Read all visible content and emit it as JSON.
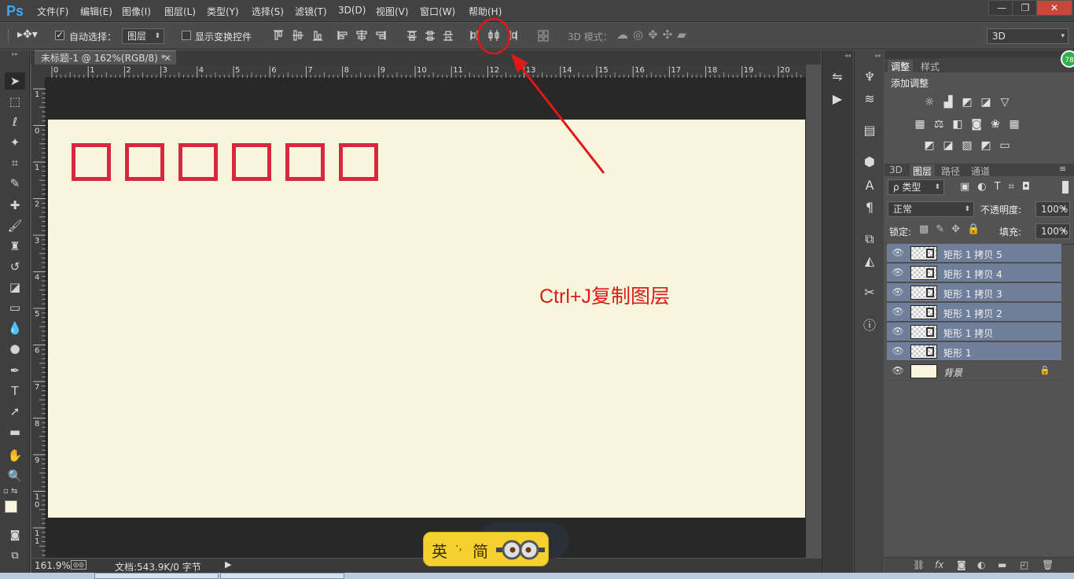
{
  "app": {
    "logo": "Ps",
    "menu": [
      "文件(F)",
      "编辑(E)",
      "图像(I)",
      "图层(L)",
      "类型(Y)",
      "选择(S)",
      "滤镜(T)",
      "3D(D)",
      "视图(V)",
      "窗口(W)",
      "帮助(H)"
    ],
    "window_controls": [
      "—",
      "❐",
      "✕"
    ]
  },
  "options_bar": {
    "auto_select_label": "自动选择：",
    "auto_select_checked": true,
    "auto_select_target": "图层",
    "show_transform_label": "显示变换控件",
    "show_transform_checked": false,
    "mode_3d_label": "3D 模式：",
    "workspace_select": "3D"
  },
  "document": {
    "tab_title": "未标题-1 @ 162%(RGB/8) *",
    "zoom": "161.9%",
    "doc_info": "文档:543.9K/0 字节",
    "canvas_color": "#f8f7de",
    "box_color": "#d8283f",
    "box_count": 6
  },
  "rulers": {
    "h_ticks": [
      "0",
      "1",
      "2",
      "3",
      "4",
      "5",
      "6",
      "7",
      "8",
      "9",
      "10",
      "11",
      "12",
      "13",
      "14",
      "15",
      "16",
      "17",
      "18",
      "19",
      "20"
    ],
    "v_ticks": [
      "1",
      "0",
      "1",
      "2",
      "3",
      "4",
      "5",
      "6",
      "7",
      "8",
      "9",
      "1 0",
      "1 1"
    ]
  },
  "annotation": {
    "text": "Ctrl+J复制图层",
    "color": "#e01818"
  },
  "adjust_panel": {
    "tabs": [
      "调整",
      "样式"
    ],
    "title": "添加调整",
    "badge": "78"
  },
  "layers_panel": {
    "tabs": [
      "3D",
      "图层",
      "路径",
      "通道"
    ],
    "filter_label": "ρ 类型",
    "blend_mode": "正常",
    "opacity_label": "不透明度:",
    "opacity_value": "100%",
    "lock_label": "锁定:",
    "fill_label": "填充:",
    "fill_value": "100%",
    "layers": [
      {
        "name": "矩形 1 拷贝 5",
        "selected": true
      },
      {
        "name": "矩形 1 拷贝 4",
        "selected": true
      },
      {
        "name": "矩形 1 拷贝 3",
        "selected": true
      },
      {
        "name": "矩形 1 拷贝 2",
        "selected": true
      },
      {
        "name": "矩形 1 拷贝",
        "selected": true
      },
      {
        "name": "矩形 1",
        "selected": true
      },
      {
        "name": "背景",
        "selected": false
      }
    ],
    "footer_icons": [
      "link-icon",
      "fx-icon",
      "mask-icon",
      "adjustment-icon",
      "folder-icon",
      "new-layer-icon",
      "trash-icon"
    ]
  },
  "ime": {
    "lang": "英",
    "sep": "·,",
    "mode": "简"
  }
}
